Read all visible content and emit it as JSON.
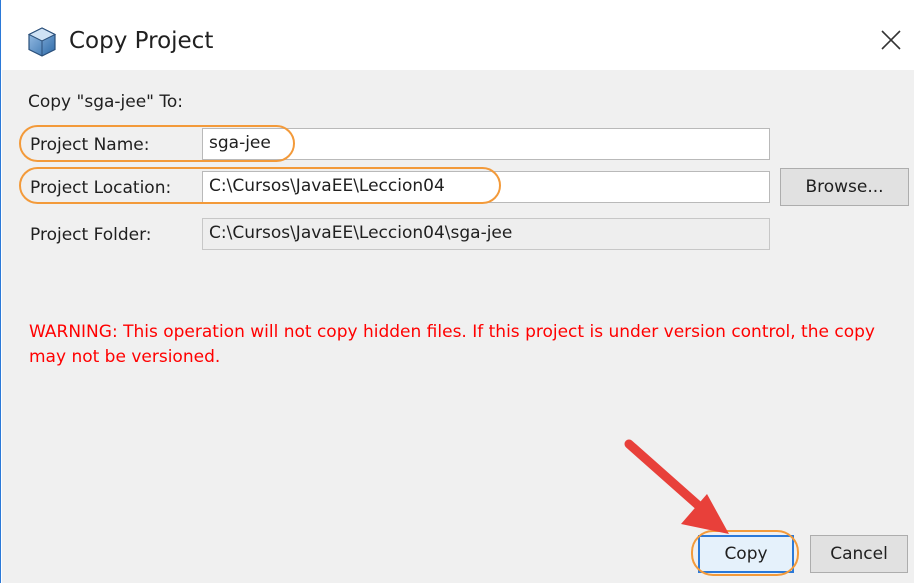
{
  "dialog": {
    "title": "Copy Project",
    "heading": "Copy \"sga-jee\" To:",
    "fields": {
      "project_name": {
        "label": "Project Name:",
        "value": "sga-jee"
      },
      "project_location": {
        "label": "Project Location:",
        "value": "C:\\Cursos\\JavaEE\\Leccion04"
      },
      "project_folder": {
        "label": "Project Folder:",
        "value": "C:\\Cursos\\JavaEE\\Leccion04\\sga-jee"
      }
    },
    "browse_label": "Browse...",
    "warning": "WARNING: This operation will not copy hidden files. If this project is under version control, the copy may not be versioned.",
    "buttons": {
      "copy": "Copy",
      "cancel": "Cancel"
    }
  },
  "icons": {
    "app": "netbeans-project-icon",
    "close": "close-icon",
    "annotation_arrow": "arrow-annotation-icon"
  },
  "colors": {
    "accent_blue": "#2b79d8",
    "warning_red": "#ff0000",
    "highlight_orange": "#f39a3a",
    "arrow_red": "#e8403a",
    "dialog_bg": "#f0f0f0"
  }
}
